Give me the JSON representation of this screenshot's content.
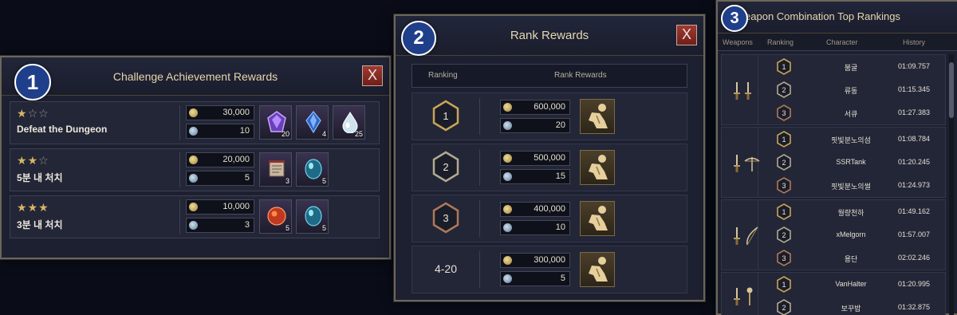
{
  "badges": [
    "1",
    "2",
    "3"
  ],
  "challenge_panel": {
    "title": "Challenge Achievement Rewards",
    "close_label": "X",
    "rows": [
      {
        "stars": 1,
        "label": "Defeat the Dungeon",
        "currency": [
          {
            "type": "gold",
            "amount": "30,000"
          },
          {
            "type": "silver",
            "amount": "10"
          }
        ],
        "items": [
          {
            "icon": "purple-gem-icon",
            "qty": "20"
          },
          {
            "icon": "blue-crystal-icon",
            "qty": "4"
          },
          {
            "icon": "water-drop-icon",
            "qty": "25"
          }
        ]
      },
      {
        "stars": 2,
        "label": "5분 내 처치",
        "currency": [
          {
            "type": "gold",
            "amount": "20,000"
          },
          {
            "type": "silver",
            "amount": "5"
          }
        ],
        "items": [
          {
            "icon": "scroll-icon",
            "qty": "3"
          },
          {
            "icon": "blue-orb-icon",
            "qty": "5"
          }
        ]
      },
      {
        "stars": 3,
        "label": "3분 내 처치",
        "currency": [
          {
            "type": "gold",
            "amount": "10,000"
          },
          {
            "type": "silver",
            "amount": "3"
          }
        ],
        "items": [
          {
            "icon": "red-orb-icon",
            "qty": "5"
          },
          {
            "icon": "blue-orb-icon",
            "qty": "5"
          }
        ]
      }
    ]
  },
  "rank_panel": {
    "title": "Rank Rewards",
    "close_label": "X",
    "columns": [
      "Ranking",
      "Rank Rewards"
    ],
    "rows": [
      {
        "rank": "1",
        "gold": "600,000",
        "silver": "20"
      },
      {
        "rank": "2",
        "gold": "500,000",
        "silver": "15"
      },
      {
        "rank": "3",
        "gold": "400,000",
        "silver": "10"
      },
      {
        "rank": "4-20",
        "gold": "300,000",
        "silver": "5"
      }
    ],
    "reward_icon": "kneeling-figure-icon"
  },
  "rankings_panel": {
    "title": "Weapon Combination Top Rankings",
    "columns": [
      "Weapons",
      "Ranking",
      "Character",
      "History"
    ],
    "groups": [
      {
        "weapons": [
          "dagger-icon",
          "dagger-icon"
        ],
        "entries": [
          {
            "rank": "1",
            "character": "붐굴",
            "history": "01:09.757"
          },
          {
            "rank": "2",
            "character": "류동",
            "history": "01:15.345"
          },
          {
            "rank": "3",
            "character": "서큐",
            "history": "01:27.383"
          }
        ]
      },
      {
        "weapons": [
          "dagger-icon",
          "crossbow-icon"
        ],
        "entries": [
          {
            "rank": "1",
            "character": "핏빛분노의섬",
            "history": "01:08.784"
          },
          {
            "rank": "2",
            "character": "SSRTank",
            "history": "01:20.245"
          },
          {
            "rank": "3",
            "character": "핏빛분노의썰",
            "history": "01:24.973"
          }
        ]
      },
      {
        "weapons": [
          "dagger-icon",
          "bow-icon"
        ],
        "entries": [
          {
            "rank": "1",
            "character": "월량천하",
            "history": "01:49.162"
          },
          {
            "rank": "2",
            "character": "xMelgorn",
            "history": "01:57.007"
          },
          {
            "rank": "3",
            "character": "용단",
            "history": "02:02.246"
          }
        ]
      },
      {
        "weapons": [
          "dagger-icon",
          "staff-icon"
        ],
        "entries": [
          {
            "rank": "1",
            "character": "VanHalter",
            "history": "01:20.995"
          },
          {
            "rank": "2",
            "character": "보꾸밥",
            "history": "01:32.875"
          }
        ]
      }
    ]
  }
}
